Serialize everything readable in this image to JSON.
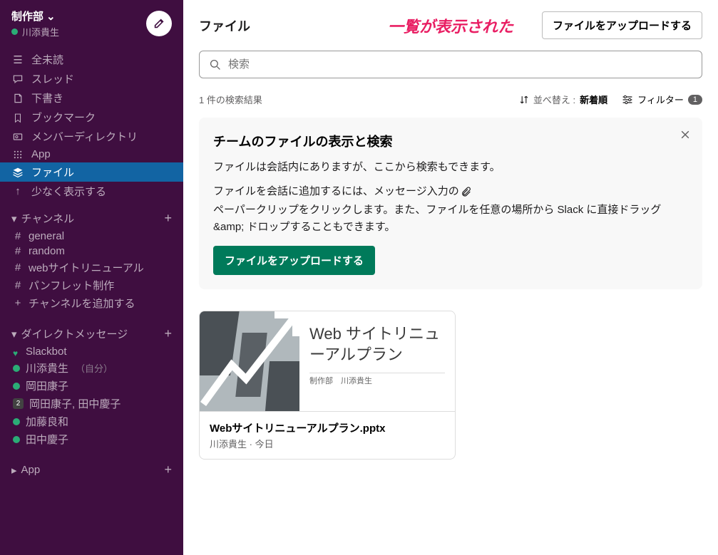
{
  "sidebar": {
    "workspace": "制作部",
    "user": "川添貴生",
    "nav": [
      {
        "icon": "☰",
        "label": "全未読"
      },
      {
        "icon": "speech",
        "label": "スレッド"
      },
      {
        "icon": "paper",
        "label": "下書き"
      },
      {
        "icon": "bookmark",
        "label": "ブックマーク"
      },
      {
        "icon": "card",
        "label": "メンバーディレクトリ"
      },
      {
        "icon": "grid",
        "label": "App"
      },
      {
        "icon": "stack",
        "label": "ファイル",
        "active": true
      },
      {
        "icon": "↑",
        "label": "少なく表示する"
      }
    ],
    "channels_header": "チャンネル",
    "channels": [
      "general",
      "random",
      "webサイトリニューアル",
      "パンフレット制作"
    ],
    "add_channel": "チャンネルを追加する",
    "dm_header": "ダイレクトメッセージ",
    "dms": [
      {
        "name": "Slackbot",
        "status": "heart"
      },
      {
        "name": "川添貴生",
        "status": "online",
        "you": "（自分）"
      },
      {
        "name": "岡田康子",
        "status": "online"
      },
      {
        "name": "岡田康子, 田中慶子",
        "status": "badge",
        "badge": "2"
      },
      {
        "name": "加藤良和",
        "status": "online"
      },
      {
        "name": "田中慶子",
        "status": "online"
      }
    ],
    "app_header": "App"
  },
  "header": {
    "title": "ファイル",
    "annotation": "一覧が表示された",
    "upload_btn": "ファイルをアップロードする"
  },
  "search": {
    "placeholder": "検索"
  },
  "results": {
    "count": "1 件の検索結果",
    "sort_label": "並べ替え :",
    "sort_value": "新着順",
    "filter_label": "フィルター",
    "filter_count": "1"
  },
  "info": {
    "title": "チームのファイルの表示と検索",
    "line1": "ファイルは会話内にありますが、ここから検索もできます。",
    "line2a": "ファイルを会話に追加するには、メッセージ入力の",
    "line2b": "ペーパークリップをクリックします。また、ファイルを任意の場所から Slack に直接ドラッグ &amp; ドロップすることもできます。",
    "upload_btn": "ファイルをアップロードする"
  },
  "file": {
    "doc_title": "Web サイトリニューアルプラン",
    "doc_sub": "制作部　川添貴生",
    "filename": "Webサイトリニューアルプラン.pptx",
    "author": "川添貴生",
    "date": "今日"
  }
}
